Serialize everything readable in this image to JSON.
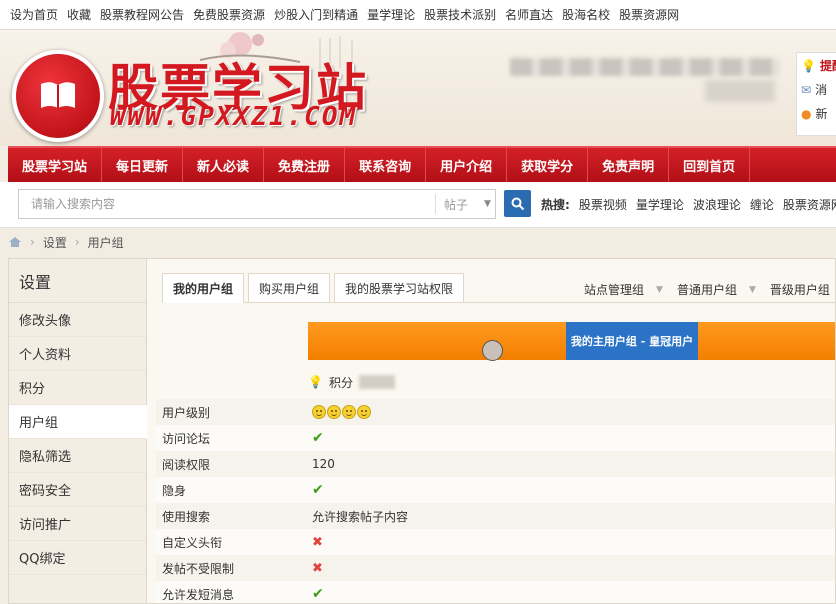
{
  "topbar": {
    "links": [
      "设为首页",
      "收藏",
      "股票教程网公告",
      "免费股票资源",
      "炒股入门到精通",
      "量学理论",
      "股票技术派别",
      "名师直达",
      "股海名校",
      "股票资源网"
    ]
  },
  "header": {
    "logo_title": "股票学习站",
    "logo_url": "WWW.GPXXZ1.COM",
    "notices": [
      "提醒",
      "消",
      "新"
    ]
  },
  "nav": {
    "items": [
      "股票学习站",
      "每日更新",
      "新人必读",
      "免费注册",
      "联系咨询",
      "用户介绍",
      "获取学分",
      "免责声明",
      "回到首页"
    ]
  },
  "search": {
    "placeholder": "请输入搜索内容",
    "type": "帖子",
    "hot_label": "热搜:",
    "hot_items": [
      "股票视频",
      "量学理论",
      "波浪理论",
      "缠论",
      "股票资源网"
    ]
  },
  "breadcrumb": {
    "items": [
      "设置",
      "用户组"
    ]
  },
  "sidebar": {
    "title": "设置",
    "items": [
      "修改头像",
      "个人资料",
      "积分",
      "用户组",
      "隐私筛选",
      "密码安全",
      "访问推广",
      "QQ绑定"
    ],
    "active_index": 3
  },
  "tabs": [
    "我的用户组",
    "购买用户组",
    "我的股票学习站权限"
  ],
  "group_links": [
    "站点管理组",
    "普通用户组",
    "晋级用户组"
  ],
  "banner": {
    "label": "我的主用户组 - 皇冠用户"
  },
  "points_label": "积分",
  "permissions": [
    {
      "label": "用户级别",
      "type": "faces",
      "count": 4
    },
    {
      "label": "访问论坛",
      "type": "yes"
    },
    {
      "label": "阅读权限",
      "type": "text",
      "value": "120"
    },
    {
      "label": "隐身",
      "type": "yes"
    },
    {
      "label": "使用搜索",
      "type": "text",
      "value": "允许搜索帖子内容"
    },
    {
      "label": "自定义头衔",
      "type": "no"
    },
    {
      "label": "发帖不受限制",
      "type": "no"
    },
    {
      "label": "允许发短消息",
      "type": "yes"
    }
  ],
  "colors": {
    "nav_red": "#c3141b",
    "banner_orange": "#f37f00",
    "banner_blue": "#2b73c6",
    "check_green": "#3c9a14",
    "cross_red": "#e0443c"
  }
}
